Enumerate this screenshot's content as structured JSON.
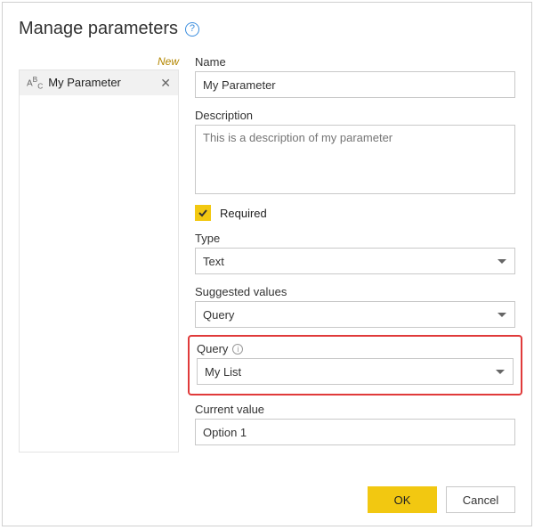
{
  "header": {
    "title": "Manage parameters"
  },
  "sidebar": {
    "new_link": "New",
    "items": [
      {
        "name": "My Parameter"
      }
    ]
  },
  "form": {
    "name_label": "Name",
    "name_value": "My Parameter",
    "description_label": "Description",
    "description_placeholder": "This is a description of my parameter",
    "required_label": "Required",
    "required_checked": true,
    "type_label": "Type",
    "type_value": "Text",
    "suggested_label": "Suggested values",
    "suggested_value": "Query",
    "query_label": "Query",
    "query_value": "My List",
    "current_value_label": "Current value",
    "current_value": "Option 1"
  },
  "footer": {
    "ok": "OK",
    "cancel": "Cancel"
  }
}
